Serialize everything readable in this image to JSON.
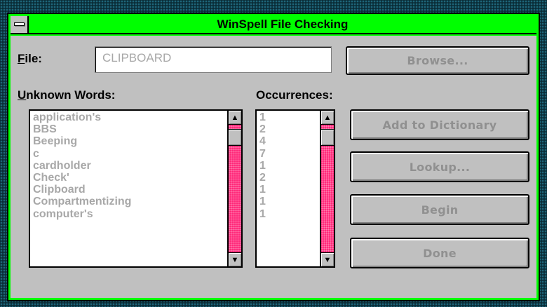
{
  "window": {
    "title": "WinSpell File Checking"
  },
  "file": {
    "label_mnemonic": "F",
    "label_rest": "ile:",
    "value": "CLIPBOARD"
  },
  "buttons": {
    "browse": "Browse...",
    "add_to_dictionary": "Add to Dictionary",
    "lookup": "Lookup...",
    "begin": "Begin",
    "done": "Done"
  },
  "unknown_words": {
    "label_mnemonic": "U",
    "label_rest": "nknown Words:",
    "items": [
      "application's",
      "BBS",
      "Beeping",
      "c",
      "cardholder",
      "Check'",
      "Clipboard",
      "Compartmentizing",
      "computer's"
    ]
  },
  "occurrences": {
    "label": "Occurrences:",
    "items": [
      "1",
      "2",
      "4",
      "7",
      "1",
      "2",
      "1",
      "1",
      "1"
    ]
  },
  "icons": {
    "system_menu": "system-menu-icon",
    "scroll_up": "▲",
    "scroll_down": "▼"
  },
  "colors": {
    "title_bar": "#00ff00",
    "dialog_face": "#c0c0c0",
    "scroll_track": "#ff2a7a",
    "disabled_text": "#a8a8a8"
  }
}
